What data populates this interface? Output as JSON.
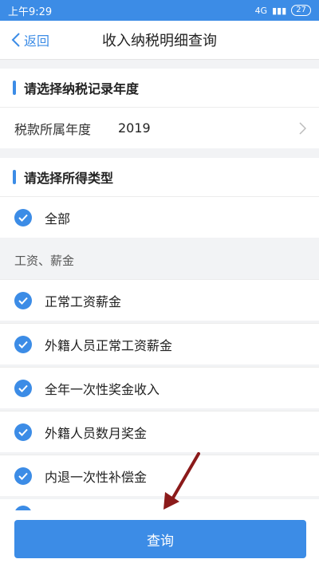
{
  "statusbar": {
    "time": "上午9:29",
    "signal": "4G",
    "battery": "27"
  },
  "nav": {
    "back_label": "返回",
    "title": "收入纳税明细查询"
  },
  "section_year": {
    "title": "请选择纳税记录年度"
  },
  "year_row": {
    "label": "税款所属年度",
    "value": "2019"
  },
  "section_type": {
    "title": "请选择所得类型"
  },
  "all_item": {
    "label": "全部",
    "checked": true
  },
  "group": {
    "title": "工资、薪金"
  },
  "items": [
    {
      "label": "正常工资薪金",
      "checked": true
    },
    {
      "label": "外籍人员正常工资薪金",
      "checked": true
    },
    {
      "label": "全年一次性奖金收入",
      "checked": true
    },
    {
      "label": "外籍人员数月奖金",
      "checked": true
    },
    {
      "label": "内退一次性补偿金",
      "checked": true
    }
  ],
  "query_button": {
    "label": "查询"
  },
  "colors": {
    "accent": "#3c8ce6",
    "annotation_arrow": "#8b1a1a"
  }
}
